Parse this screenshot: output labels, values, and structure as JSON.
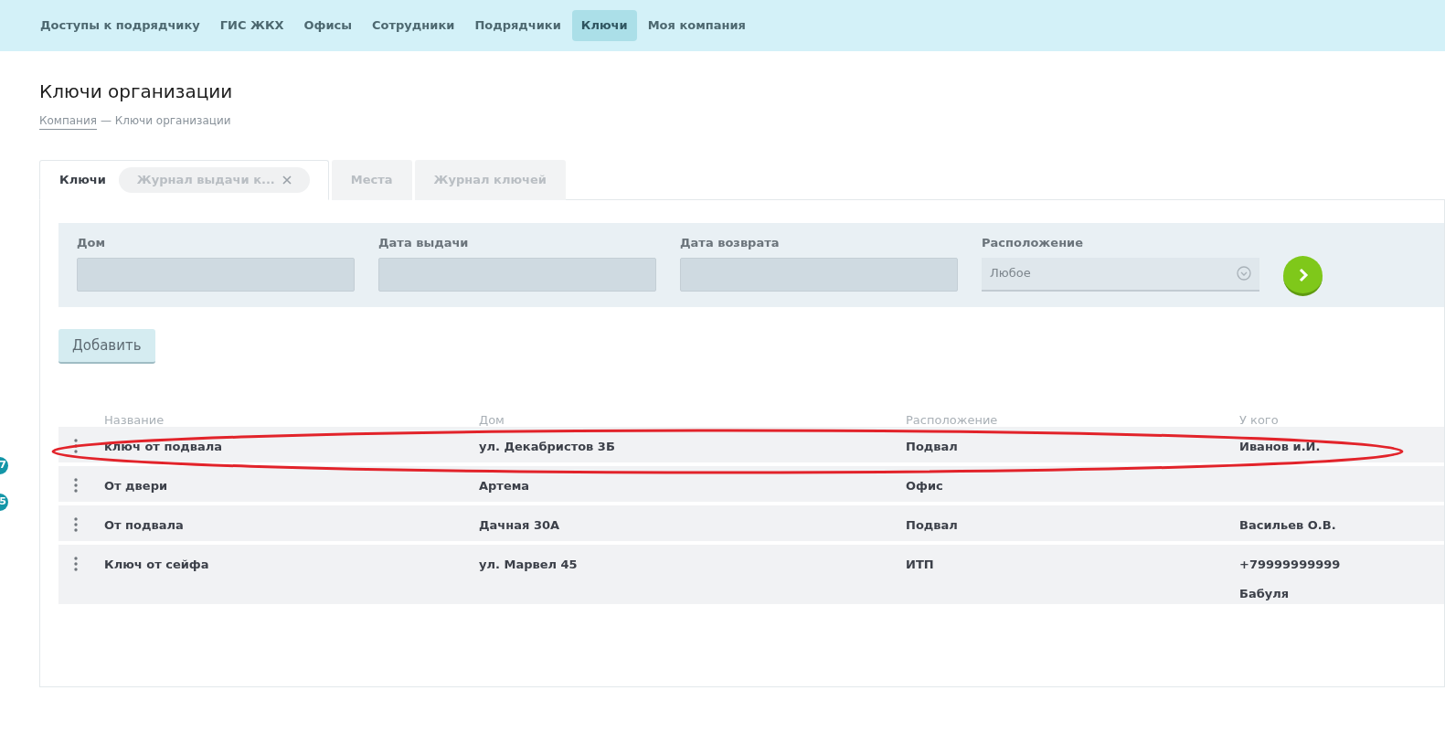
{
  "nav": [
    {
      "label": "Доступы к подрядчику",
      "selected": false
    },
    {
      "label": "ГИС ЖКХ",
      "selected": false
    },
    {
      "label": "Офисы",
      "selected": false
    },
    {
      "label": "Сотрудники",
      "selected": false
    },
    {
      "label": "Подрядчики",
      "selected": false
    },
    {
      "label": "Ключи",
      "selected": true
    },
    {
      "label": "Моя компания",
      "selected": false
    }
  ],
  "page_title": "Ключи организации",
  "breadcrumb": {
    "link": "Компания",
    "current": "— Ключи организации"
  },
  "tabs": [
    {
      "label": "Ключи",
      "kind": "plain",
      "selected": true
    },
    {
      "label": "Журнал выдачи к...",
      "kind": "closable",
      "selected": false
    },
    {
      "label": "Места",
      "kind": "plain",
      "selected": false
    },
    {
      "label": "Журнал ключей",
      "kind": "plain",
      "selected": false
    }
  ],
  "filters": [
    {
      "label": "Дом",
      "kind": "text"
    },
    {
      "label": "Дата выдачи",
      "kind": "text"
    },
    {
      "label": "Дата возврата",
      "kind": "text"
    },
    {
      "label": "Расположение",
      "kind": "select",
      "value": "Любое"
    }
  ],
  "add_button": "Добавить",
  "table": {
    "columns": [
      "Название",
      "Дом",
      "Расположение",
      "У кого"
    ],
    "rows": [
      {
        "cells": [
          "ключ от подвала",
          "ул. Декабристов 3Б",
          "Подвал",
          [
            "Иванов и.И."
          ]
        ],
        "circled": true
      },
      {
        "cells": [
          "От двери",
          "Артема",
          "Офис",
          []
        ],
        "circled": false
      },
      {
        "cells": [
          "От подвала",
          "Дачная 30А",
          "Подвал",
          [
            "Васильев О.В."
          ]
        ],
        "circled": false
      },
      {
        "cells": [
          "Ключ от сейфа",
          "ул. Марвел 45",
          "ИТП",
          [
            "+79999999999",
            "Бабуля"
          ]
        ],
        "circled": false
      }
    ]
  },
  "side_badges": [
    "7",
    "5"
  ]
}
